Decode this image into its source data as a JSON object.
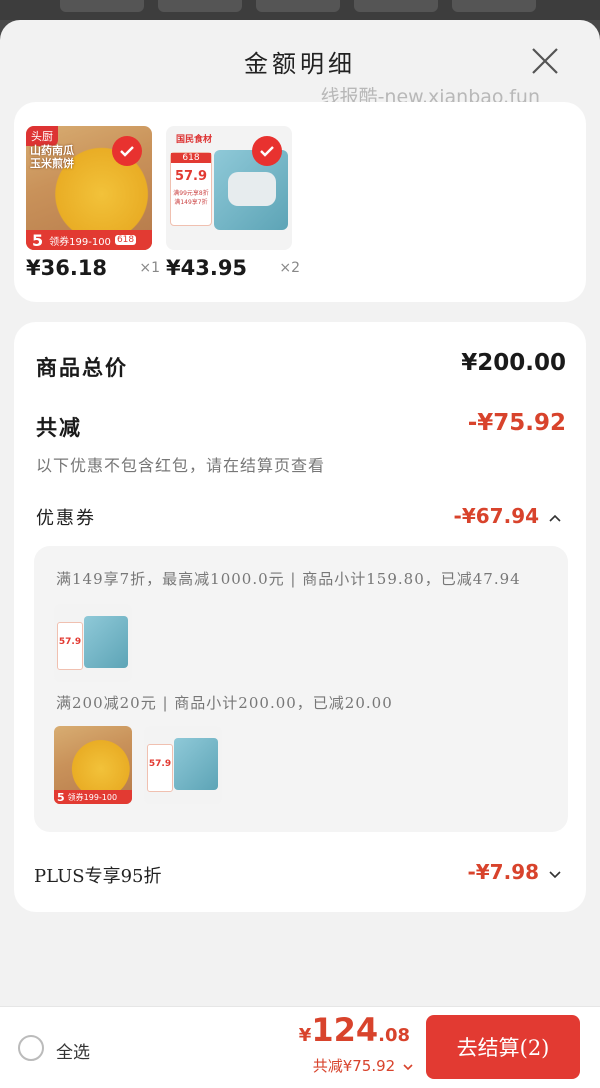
{
  "sheet": {
    "title": "金额明细",
    "watermark": "线报酷-new.xianbao.fun"
  },
  "products": [
    {
      "price": "¥36.18",
      "qty": "×1",
      "badge_top": "头厨",
      "name_lines": [
        "山药南瓜",
        "玉米煎饼"
      ],
      "promo": "领券199-100",
      "promo_num": "5",
      "tag": "618"
    },
    {
      "price": "¥43.95",
      "qty": "×2",
      "badge_top": "国民食材",
      "promo_price": "57.9",
      "promo_small": "满99元享8折",
      "promo_small2": "满149享7折",
      "tag": "618"
    }
  ],
  "details": {
    "goods_total_label": "商品总价",
    "goods_total_value": "¥200.00",
    "discount_label": "共减",
    "discount_value": "-¥75.92",
    "note": "以下优惠不包含红包，请在结算页查看",
    "coupon_label": "优惠券",
    "coupon_value": "-¥67.94",
    "coupon_rules": [
      "满149享7折，最高减1000.0元 | 商品小计159.80，已减47.94",
      "满200减20元 | 商品小计200.00，已减20.00"
    ],
    "plus_label": "PLUS专享95折",
    "plus_value": "-¥7.98"
  },
  "bottom": {
    "select_all": "全选",
    "total_yen": "¥",
    "total_int": "124",
    "total_dec": ".08",
    "total_sub": "共减¥75.92",
    "checkout": "去结算(2)"
  },
  "colors": {
    "accent": "#e23a32",
    "price_red": "#d8432c"
  }
}
